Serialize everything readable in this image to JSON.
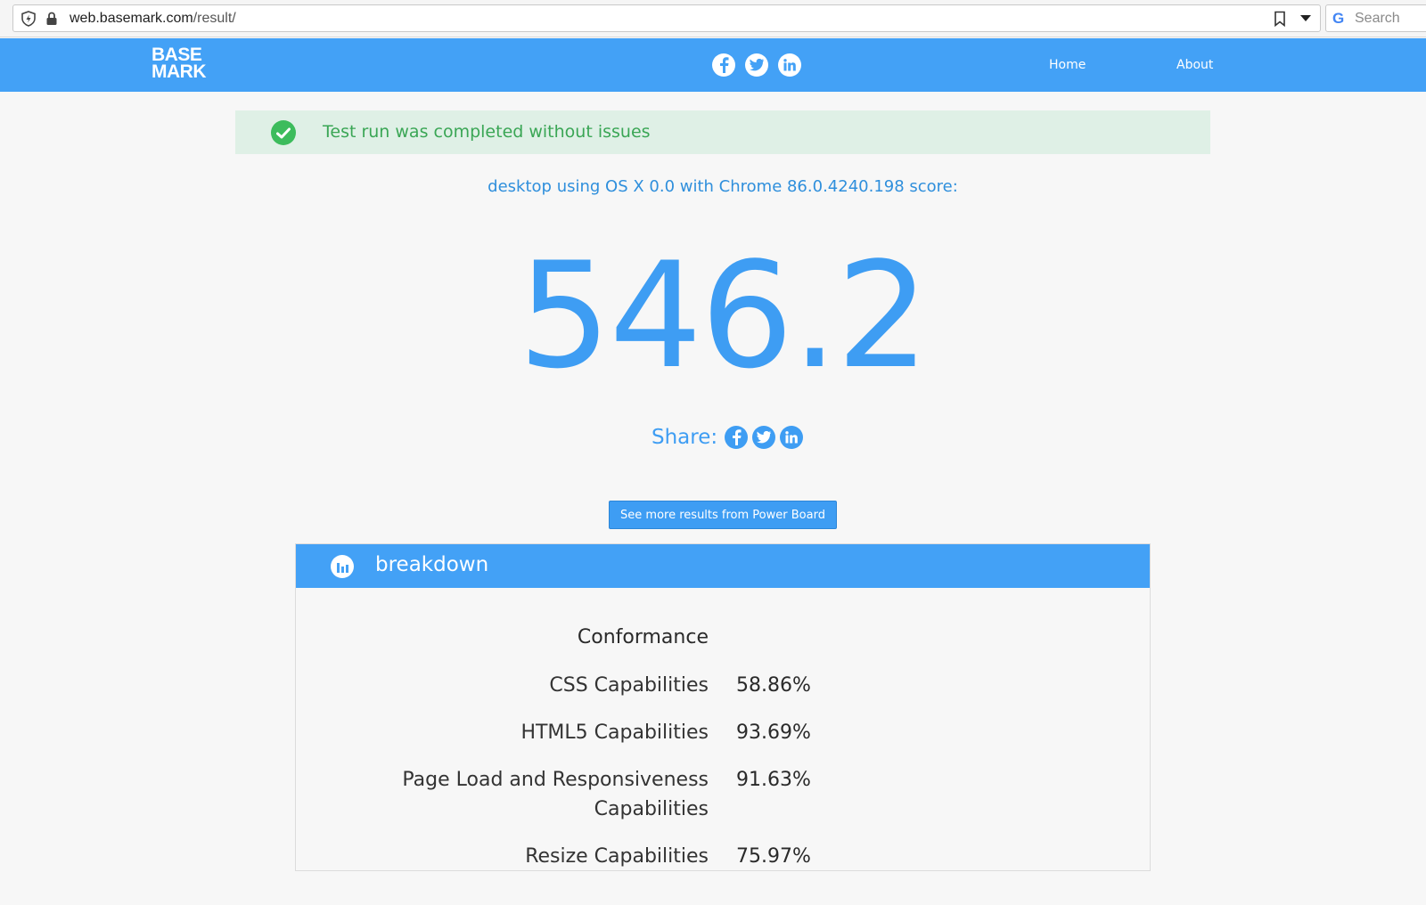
{
  "browser": {
    "url_host": "web.basemark.com",
    "url_path": "/result/",
    "search_placeholder": "Search"
  },
  "header": {
    "logo_line1": "BASE",
    "logo_line2": "MARK",
    "social_icons": [
      "facebook-icon",
      "twitter-icon",
      "linkedin-icon"
    ],
    "nav": {
      "home": "Home",
      "about": "About"
    }
  },
  "banner": {
    "message": "Test run was completed without issues"
  },
  "result": {
    "device_line": "desktop using OS X 0.0 with Chrome 86.0.4240.198 score:",
    "score": "546.2",
    "share_label": "Share:",
    "power_board_button": "See more results from Power Board"
  },
  "breakdown": {
    "title": "breakdown",
    "section": "Conformance",
    "rows": [
      {
        "label": "CSS Capabilities",
        "value": "58.86%"
      },
      {
        "label": "HTML5 Capabilities",
        "value": "93.69%"
      },
      {
        "label": "Page Load and Responsiveness Capabilities",
        "value": "91.63%"
      },
      {
        "label": "Resize Capabilities",
        "value": "75.97%"
      }
    ]
  },
  "colors": {
    "brand_blue": "#43a1f6",
    "success_green": "#3cbc5c",
    "success_bg": "#dff0e6"
  }
}
